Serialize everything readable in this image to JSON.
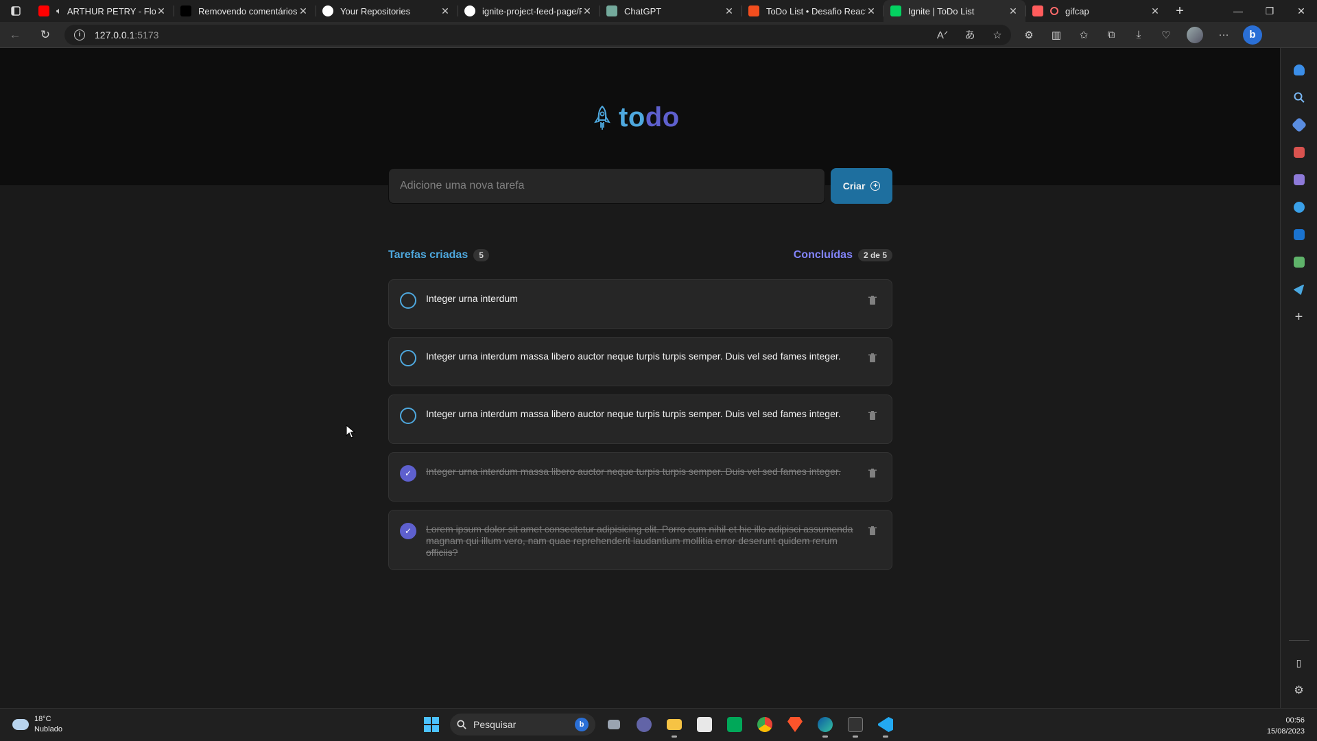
{
  "browser": {
    "tabs": [
      {
        "title": "ARTHUR PETRY - Flow",
        "favicon": "youtube-icon",
        "color": "#ff0000",
        "audio": true,
        "active": false
      },
      {
        "title": "Removendo comentários (",
        "favicon": "notion-icon",
        "color": "#000000",
        "active": false
      },
      {
        "title": "Your Repositories",
        "favicon": "github-icon",
        "color": "#ffffff",
        "active": false
      },
      {
        "title": "ignite-project-feed-page/R",
        "favicon": "github-icon",
        "color": "#ffffff",
        "active": false
      },
      {
        "title": "ChatGPT",
        "favicon": "chatgpt-icon",
        "color": "#74aa9c",
        "active": false
      },
      {
        "title": "ToDo List • Desafio React (",
        "favicon": "figma-icon",
        "color": "#f24e1e",
        "active": false
      },
      {
        "title": "Ignite | ToDo List",
        "favicon": "rocketseat-icon",
        "color": "#04d361",
        "active": true
      },
      {
        "title": "gifcap",
        "favicon": "gifcap-icon",
        "color": "#ff5c5c",
        "recording": true,
        "active": false
      }
    ],
    "close_glyph": "✕",
    "url_host": "127.0.0.1",
    "url_port": ":5173",
    "bing_label": "b"
  },
  "app": {
    "logo_text_1": "to",
    "logo_text_2": "do",
    "input_placeholder": "Adicione uma nova tarefa",
    "create_label": "Criar",
    "created_label": "Tarefas criadas",
    "created_count": "5",
    "done_label": "Concluídas",
    "done_count": "2 de 5",
    "tasks": [
      {
        "text": "Integer urna interdum",
        "done": false
      },
      {
        "text": "Integer urna interdum massa libero auctor neque turpis turpis semper. Duis vel sed fames integer.",
        "done": false
      },
      {
        "text": "Integer urna interdum massa libero auctor neque turpis turpis semper. Duis vel sed fames integer.",
        "done": false
      },
      {
        "text": "Integer urna interdum massa libero auctor neque turpis turpis semper. Duis vel sed fames integer.",
        "done": true
      },
      {
        "text": "Lorem ipsum dolor sit amet consectetur adipisicing elit. Porro cum nihil et hic illo adipisci assumenda magnam qui illum vero, nam quae reprehenderit laudantium mollitia error deserunt quidem rerum officiis?",
        "done": true
      }
    ],
    "colors": {
      "blue": "#4ea8de",
      "purple": "#5e60ce",
      "purple_light": "#8284fa",
      "button": "#1e6f9f"
    }
  },
  "taskbar": {
    "temperature": "18°C",
    "weather": "Nublado",
    "search_placeholder": "Pesquisar",
    "time": "00:56",
    "date": "15/08/2023",
    "apps": [
      "file-explorer-icon",
      "teams-icon",
      "folder-icon",
      "sticky-icon",
      "meet-icon",
      "chrome-icon",
      "brave-icon",
      "edge-icon",
      "terminal-icon",
      "vscode-icon"
    ]
  }
}
